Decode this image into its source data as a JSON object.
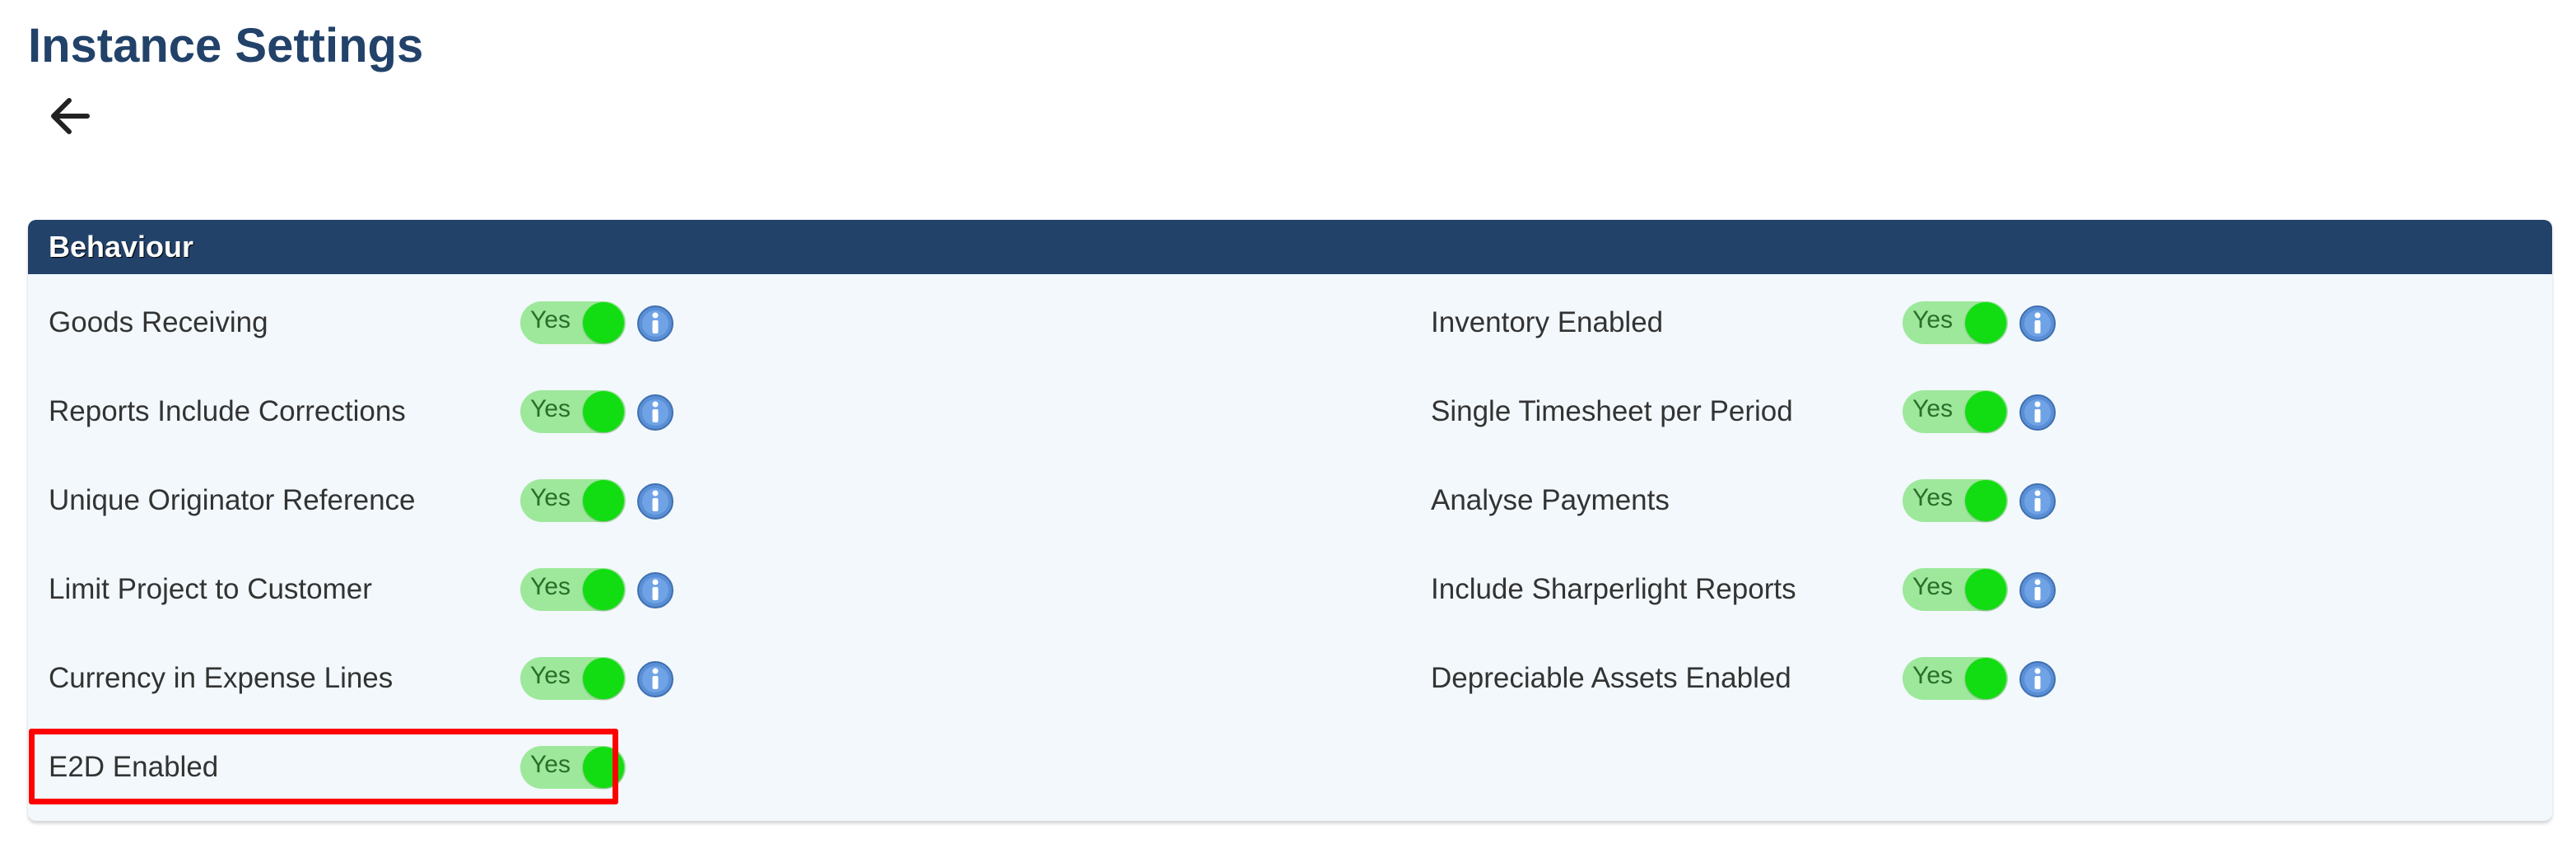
{
  "page": {
    "title": "Instance Settings"
  },
  "icons": {
    "back": "back-arrow-icon",
    "info": "info-icon"
  },
  "colors": {
    "title": "#22426a",
    "header_bg": "#22426a",
    "panel_bg": "#f2f8fb",
    "toggle_track": "#9de89b",
    "toggle_knob": "#12dd12",
    "highlight": "#ff0000"
  },
  "section": {
    "title": "Behaviour",
    "left_settings": [
      {
        "label": "Goods Receiving",
        "value": "Yes",
        "enabled": true,
        "has_info": true
      },
      {
        "label": "Reports Include Corrections",
        "value": "Yes",
        "enabled": true,
        "has_info": true
      },
      {
        "label": "Unique Originator Reference",
        "value": "Yes",
        "enabled": true,
        "has_info": true
      },
      {
        "label": "Limit Project to Customer",
        "value": "Yes",
        "enabled": true,
        "has_info": true
      },
      {
        "label": "Currency in Expense Lines",
        "value": "Yes",
        "enabled": true,
        "has_info": true
      },
      {
        "label": "E2D Enabled",
        "value": "Yes",
        "enabled": true,
        "has_info": false,
        "highlighted": true
      }
    ],
    "right_settings": [
      {
        "label": "Inventory Enabled",
        "value": "Yes",
        "enabled": true,
        "has_info": true
      },
      {
        "label": "Single Timesheet per Period",
        "value": "Yes",
        "enabled": true,
        "has_info": true
      },
      {
        "label": "Analyse Payments",
        "value": "Yes",
        "enabled": true,
        "has_info": true
      },
      {
        "label": "Include Sharperlight Reports",
        "value": "Yes",
        "enabled": true,
        "has_info": true
      },
      {
        "label": "Depreciable Assets Enabled",
        "value": "Yes",
        "enabled": true,
        "has_info": true
      }
    ]
  }
}
